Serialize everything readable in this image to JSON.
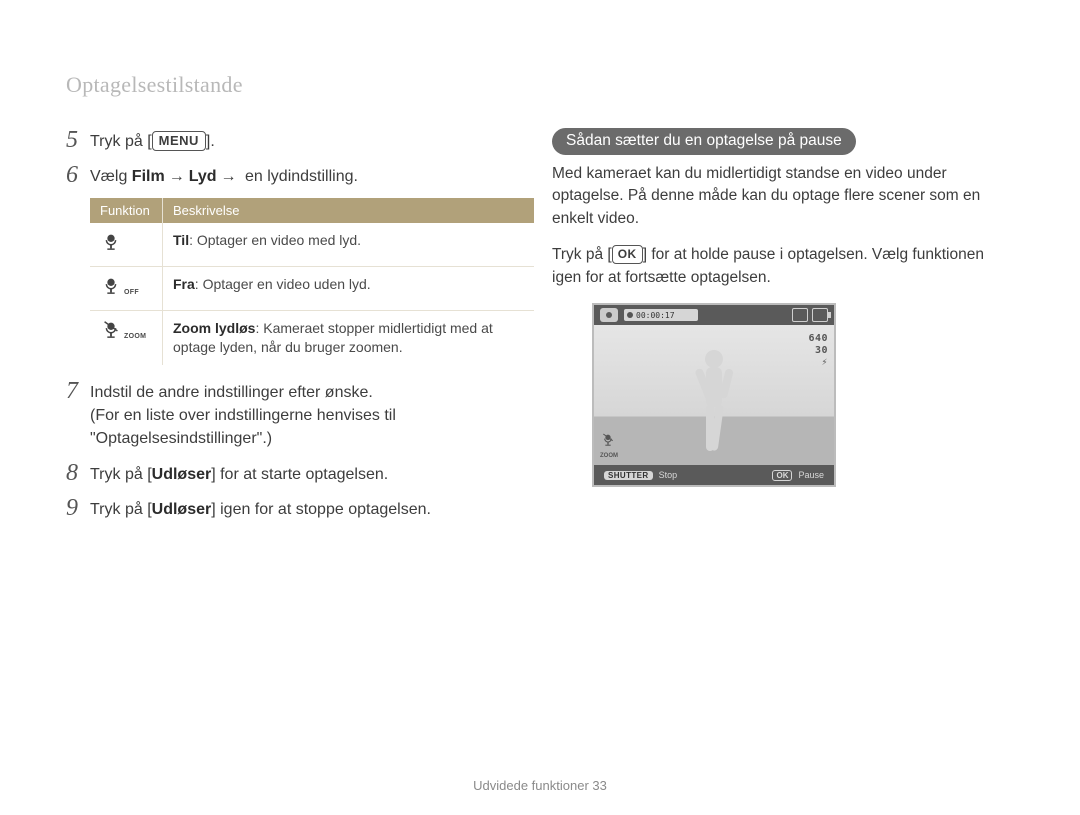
{
  "header": {
    "title": "Optagelsestilstande"
  },
  "left": {
    "step5": {
      "num": "5",
      "prefix": "Tryk på [",
      "suffix": "].",
      "menu": "MENU"
    },
    "step6": {
      "num": "6",
      "prefix": "Vælg ",
      "b1": "Film",
      "arrow": "→",
      "b2": "Lyd",
      "suffix": " en lydindstilling."
    },
    "table": {
      "h1": "Funktion",
      "h2": "Beskrivelse",
      "rows": [
        {
          "iconSub": "",
          "b": "Til",
          "t": ": Optager en video med lyd."
        },
        {
          "iconSub": "OFF",
          "b": "Fra",
          "t": ": Optager en video uden lyd."
        },
        {
          "iconSub": "ZOOM",
          "b": "Zoom lydløs",
          "t": ": Kameraet stopper midlertidigt med at optage lyden, når du bruger zoomen."
        }
      ]
    },
    "step7": {
      "num": "7",
      "l1": "Indstil de andre indstillinger efter ønske.",
      "l2": "(For en liste over indstillingerne henvises til",
      "l3": "\"Optagelsesindstillinger\".)"
    },
    "step8": {
      "num": "8",
      "prefix": "Tryk på [",
      "b": "Udløser",
      "suffix": "] for at starte optagelsen."
    },
    "step9": {
      "num": "9",
      "prefix": "Tryk på [",
      "b": "Udløser",
      "suffix": "]  igen for at stoppe optagelsen."
    }
  },
  "right": {
    "heading": "Sådan sætter du en optagelse på pause",
    "p1": "Med kameraet kan du midlertidigt standse en video under optagelse. På denne måde kan du optage flere scener som en enkelt video.",
    "p2_pre": "Tryk på [",
    "p2_ok": "OK",
    "p2_post": "] for at holde pause i optagelsen. Vælg funktionen igen for at fortsætte optagelsen.",
    "screen": {
      "time": "00:00:17",
      "res": "640",
      "fps": "30",
      "zoomSub": "ZOOM",
      "shutter": "SHUTTER",
      "stop": "Stop",
      "ok": "OK",
      "pause": "Pause"
    }
  },
  "footer": {
    "text": "Udvidede funktioner  33"
  }
}
